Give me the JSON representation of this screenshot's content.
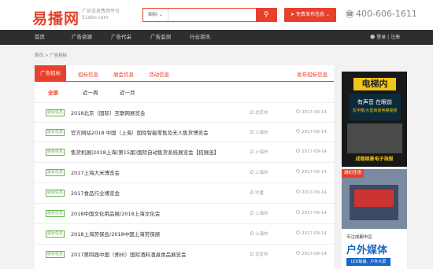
{
  "header": {
    "logo": "易播网",
    "logo_sub1": "广告信息费用平台",
    "logo_sub2": "51ebo.com",
    "search_select": "招标 ⌄",
    "search_placeholder": "",
    "search_icon": "search-icon",
    "publish_label": "免费发布信息 ⌄",
    "phone": "400-606-1611"
  },
  "nav": {
    "items": [
      "首页",
      "广告资源",
      "广告代采",
      "广告监测",
      "行业资讯"
    ],
    "login": "登录",
    "register": "注册",
    "divider": "|"
  },
  "breadcrumb": {
    "home": "首页",
    "sep": ">",
    "current": "广告招标"
  },
  "tabs": [
    "广告招标",
    "招标信息",
    "展会信息",
    "活动信息"
  ],
  "tabs_right": "发布招标信息",
  "filters": [
    "全部",
    "近一周",
    "近一月"
  ],
  "rows": [
    {
      "badge": "展会信息",
      "title": "2018北京（国际）互联网展览会",
      "city": "北京市",
      "date": "2017-09-14"
    },
    {
      "badge": "展会信息",
      "title": "官方网站2018 中国（上海）国际智能零售及无人售货博览会",
      "city": "上海市",
      "date": "2017-09-14"
    },
    {
      "badge": "展会信息",
      "title": "售货机展|2018上海(第15届)国际自动售货系统展览会【招展函】",
      "city": "上海市",
      "date": "2017-09-14"
    },
    {
      "badge": "展会信息",
      "title": "2017上海大米博览会",
      "city": "上海市",
      "date": "2017-09-14"
    },
    {
      "badge": "展会信息",
      "title": "2017食品行业博览会",
      "city": "宁夏",
      "date": "2017-09-14"
    },
    {
      "badge": "展会信息",
      "title": "2018中国文化用品展/2018上海文化会",
      "city": "上海市",
      "date": "2017-09-14"
    },
    {
      "badge": "展会信息",
      "title": "2018上海劳保会/2018中国上海劳保展",
      "city": "上海市",
      "date": "2017-09-14"
    },
    {
      "badge": "展会信息",
      "title": "2017第四届中国（郑州）国际酒料酒具食品展览会",
      "city": "北京市",
      "date": "2017-09-14"
    }
  ],
  "ads": {
    "ad1_title": "电梯内",
    "ad1_screen1": "有声音 在眼前",
    "ad1_screen2": "写字楼/大型商场电梯视频",
    "ad1_footer": "成都梯景电子海报",
    "ad2_badge": "城纪佳语",
    "ad2_line1": "专注成都市区",
    "ad2_line2": "户外媒体",
    "ad2_line3": "LED联播、户外大屏"
  },
  "colors": {
    "accent": "#e8402c",
    "nav_bg": "#2e2e2e",
    "badge_green": "#67b553"
  }
}
